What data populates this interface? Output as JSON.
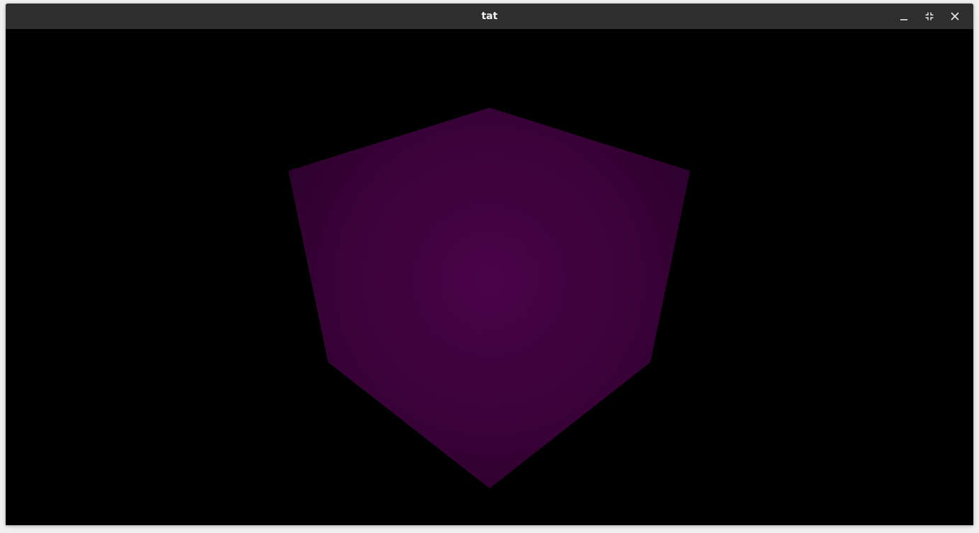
{
  "window": {
    "title": "tat"
  },
  "controls": {
    "minimize": "minimize-icon",
    "restore": "restore-icon",
    "close": "close-icon"
  },
  "scene": {
    "background": "#000000",
    "object": "cube",
    "colors": {
      "center": "#4a0348",
      "mid": "#3d023c",
      "edge": "#2d012c"
    }
  }
}
